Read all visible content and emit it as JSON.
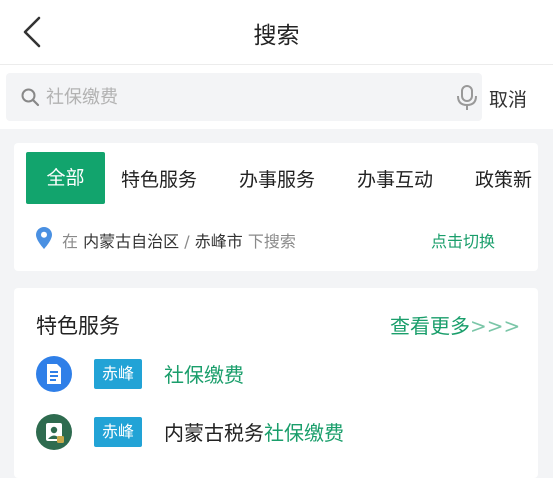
{
  "header": {
    "title": "搜索",
    "back_icon": "chevron-left-icon"
  },
  "search": {
    "placeholder": "社保缴费",
    "value": "",
    "cancel_label": "取消",
    "search_icon": "search-icon",
    "mic_icon": "microphone-icon"
  },
  "tabs": [
    {
      "label": "全部",
      "active": true
    },
    {
      "label": "特色服务",
      "active": false
    },
    {
      "label": "办事服务",
      "active": false
    },
    {
      "label": "办事互动",
      "active": false
    },
    {
      "label": "政策新",
      "active": false
    }
  ],
  "location": {
    "prefix": "在",
    "region": "内蒙古自治区",
    "separator": "/",
    "city": "赤峰市",
    "suffix": "下搜索",
    "switch_label": "点击切换",
    "icon": "location-pin-icon"
  },
  "section": {
    "title": "特色服务",
    "more_label": "查看更多",
    "more_arrows": ">>>",
    "results": [
      {
        "badge": "赤峰",
        "prefix": "",
        "highlight": "社保缴费",
        "icon": "document-icon"
      },
      {
        "badge": "赤峰",
        "prefix": "内蒙古税务",
        "highlight": "社保缴费",
        "icon": "tax-badge-icon"
      }
    ]
  },
  "colors": {
    "accent": "#12a46d",
    "link": "#1a9e6b",
    "badge": "#22a3d6",
    "background": "#f3f4f6"
  }
}
